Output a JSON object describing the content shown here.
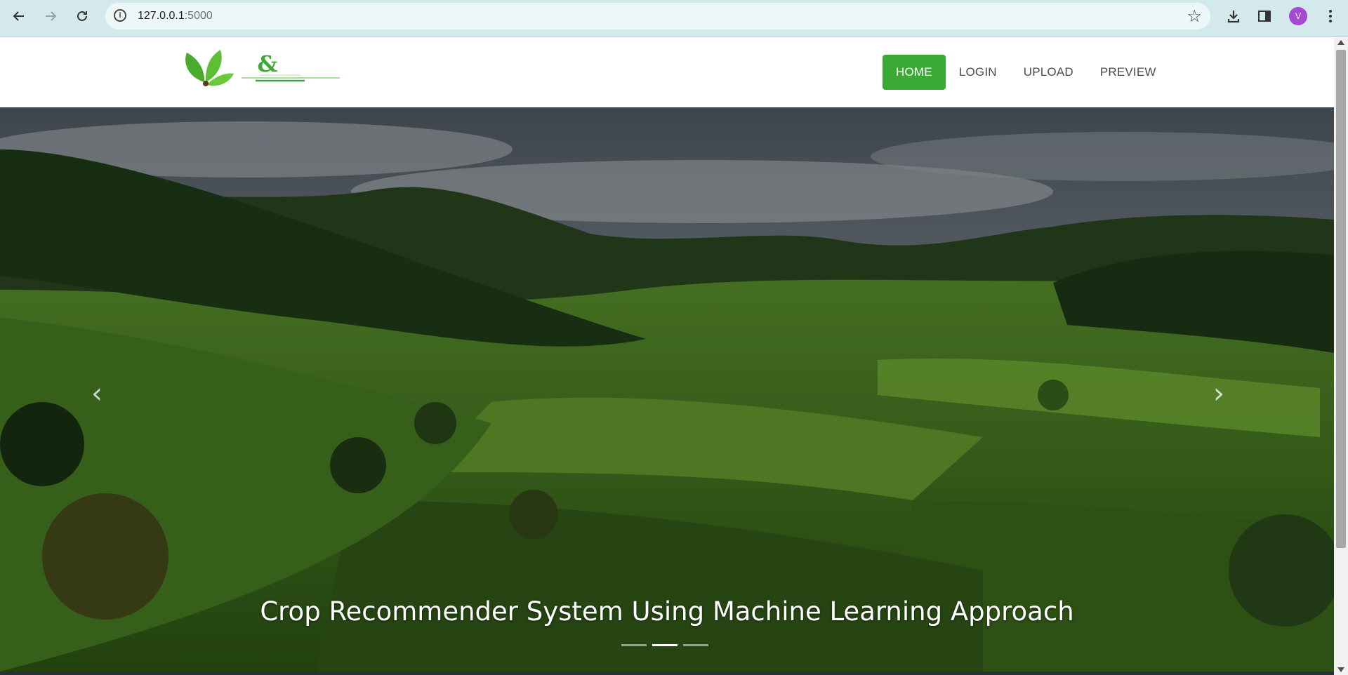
{
  "browser": {
    "url_host": "127.0.0.1",
    "url_port": ":5000",
    "avatar_letter": "V"
  },
  "logo": {
    "mark": "&"
  },
  "nav": {
    "items": [
      {
        "label": "HOME",
        "active": true
      },
      {
        "label": "LOGIN",
        "active": false
      },
      {
        "label": "UPLOAD",
        "active": false
      },
      {
        "label": "PREVIEW",
        "active": false
      }
    ]
  },
  "hero": {
    "caption": "Crop Recommender System Using Machine Learning Approach",
    "slide_count": 3,
    "active_slide": 2
  },
  "colors": {
    "accent": "#3aaa35",
    "chrome": "#d3e9ec"
  }
}
